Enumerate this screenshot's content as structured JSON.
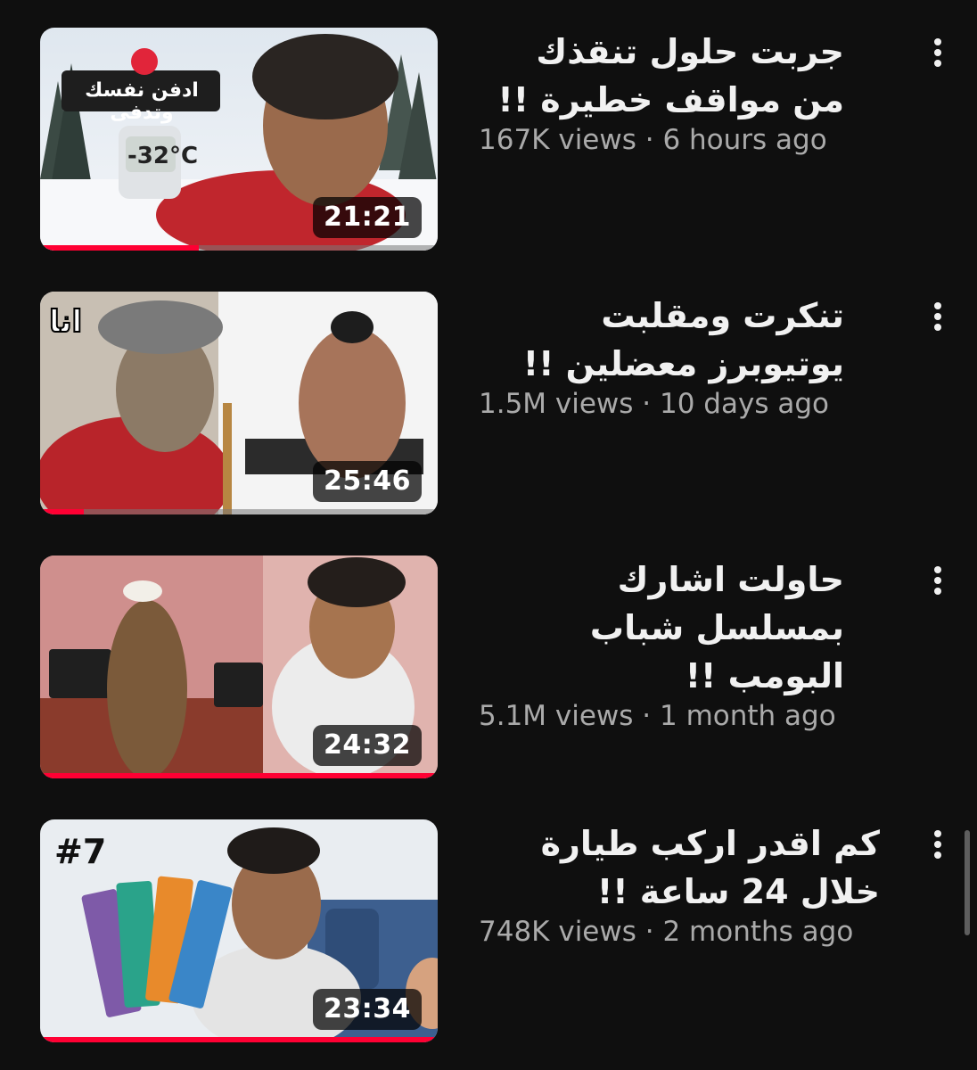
{
  "videos": [
    {
      "title": "جربت حلول تنقذك من مواقف خطيرة !!",
      "views": "167K views",
      "age": "6 hours ago",
      "duration": "21:21",
      "watched_fraction": 0.4,
      "overlay_text": "ادفن نفسك وتدفى",
      "overlay_subtext": "-32°C",
      "icon": "snow-scene-icon"
    },
    {
      "title": "تنكرت ومقلبت يوتيوبرز معضلين !!",
      "views": "1.5M views",
      "age": "10 days ago",
      "duration": "25:46",
      "watched_fraction": 0.11,
      "overlay_text": "انا",
      "icon": "gym-scene-icon"
    },
    {
      "title": "حاولت اشارك بمسلسل شباب البومب !!",
      "views": "5.1M views",
      "age": "1 month ago",
      "duration": "24:32",
      "watched_fraction": 1.0,
      "icon": "film-set-icon"
    },
    {
      "title": "كم اقدر اركب طيارة خلال 24 ساعة !!",
      "views": "748K views",
      "age": "2 months ago",
      "duration": "23:34",
      "watched_fraction": 1.0,
      "overlay_text": "#7",
      "icon": "airplane-scene-icon"
    }
  ],
  "separator": " · ",
  "colors": {
    "background": "#0f0f0f",
    "title": "#f1f1f1",
    "meta": "#aaaaaa",
    "progress": "#ff0033"
  }
}
